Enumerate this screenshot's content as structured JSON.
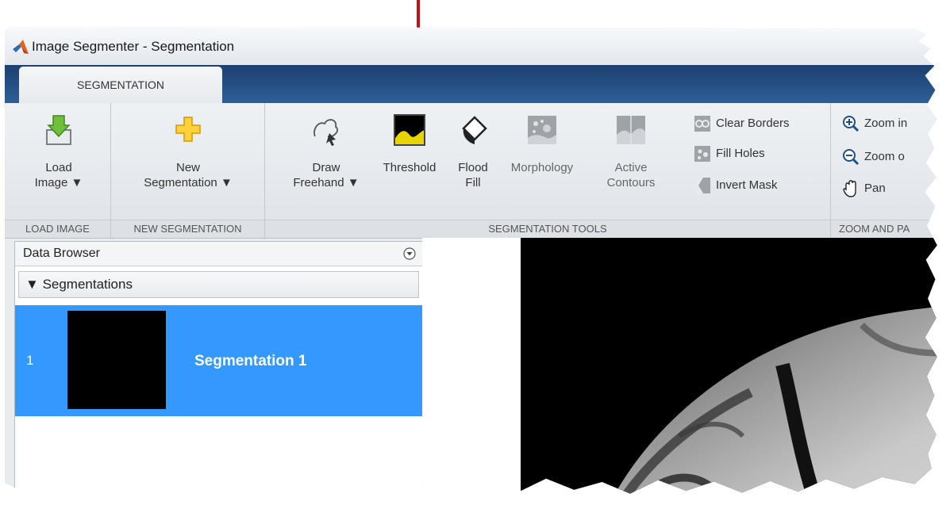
{
  "window": {
    "title": "Image Segmenter - Segmentation"
  },
  "tabs": [
    {
      "label": "SEGMENTATION"
    }
  ],
  "toolstrip": {
    "load_image": {
      "line1": "Load",
      "line2": "Image",
      "section_label": "LOAD IMAGE"
    },
    "new_segmentation": {
      "line1": "New",
      "line2": "Segmentation",
      "section_label": "NEW SEGMENTATION"
    },
    "segmentation_tools": {
      "section_label": "SEGMENTATION TOOLS",
      "draw_freehand": {
        "line1": "Draw",
        "line2": "Freehand"
      },
      "threshold": {
        "label": "Threshold"
      },
      "flood_fill": {
        "line1": "Flood",
        "line2": "Fill"
      },
      "morphology": {
        "label": "Morphology"
      },
      "active_contours": {
        "line1": "Active",
        "line2": "Contours"
      },
      "clear_borders": "Clear Borders",
      "fill_holes": "Fill Holes",
      "invert_mask": "Invert Mask"
    },
    "zoom_and_pan": {
      "section_label": "ZOOM AND PA",
      "zoom_in": "Zoom in",
      "zoom_out": "Zoom o",
      "pan": "Pan"
    }
  },
  "data_browser": {
    "title": "Data Browser",
    "group_label": "Segmentations",
    "items": [
      {
        "index": "1",
        "name": "Segmentation 1"
      }
    ]
  },
  "colors": {
    "tab_strip": "#1c3f6e",
    "selection": "#3399ff",
    "arrow": "#c0121b",
    "threshold_icon": "#e8d400"
  },
  "annotation": {
    "type": "arrow",
    "points_to": "threshold"
  }
}
